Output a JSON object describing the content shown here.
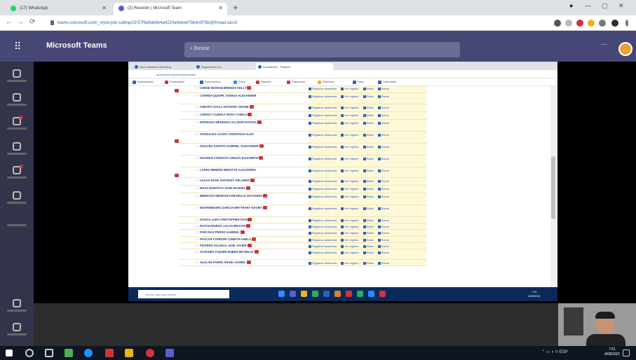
{
  "browser": {
    "tabs": [
      {
        "title": "(17) WhatsApp",
        "color": "#25d366"
      },
      {
        "title": "(2) Reunión | Microsoft Team",
        "color": "#5b5fc7"
      }
    ],
    "url": "teams.microsoft.com/_#/pre-join-calling/19:57f5e6de6e4a4220a4ebeb7bb4c0f7bb@thread.tacv2",
    "window_controls": [
      "—",
      "▢",
      "✕"
    ]
  },
  "teams": {
    "app_name": "Microsoft Teams",
    "search_placeholder": "Buscar",
    "more_label": "···",
    "rail": [
      {
        "icon": "activity-icon",
        "badge": false
      },
      {
        "icon": "chat-icon",
        "badge": false
      },
      {
        "icon": "teams-icon",
        "badge": true
      },
      {
        "icon": "assignments-icon",
        "badge": false
      },
      {
        "icon": "calendar-icon",
        "badge": true
      },
      {
        "icon": "calls-icon",
        "badge": false
      },
      {
        "icon": "more-apps-icon",
        "badge": false
      },
      {
        "icon": "apps-icon",
        "badge": false
      },
      {
        "icon": "help-icon",
        "badge": false
      }
    ]
  },
  "shared": {
    "tabs": [
      "Inicio (sistema educativo)",
      "Seguimiento de...",
      "Estudiantes - Registro"
    ],
    "url": "aulavirtual.edu/estudiantes/lista",
    "bookmarks": [
      "Aplicaciones",
      "Formularios",
      "Documentos",
      "Zoom",
      "Sistema",
      "Classroom",
      "Recursos",
      "Drive",
      "Calendario"
    ],
    "actions": [
      "Registrar asistencia",
      "Ver registro",
      "Editar",
      "Borrar"
    ],
    "rows": [
      {
        "name": "CHENE MAMANI BRENDA KELLY",
        "flag": true,
        "lead": true,
        "h": 11
      },
      {
        "name": "CORREA QUISPE JOSHUA ALEXANDER",
        "flag": false,
        "lead": false,
        "h": 16
      },
      {
        "name": "CRESPO AYALA ANTHONY SHANE",
        "flag": true,
        "lead": false,
        "h": 11
      },
      {
        "name": "CUENCA CUENCA ROSA CAMILA",
        "flag": true,
        "lead": false,
        "h": 11
      },
      {
        "name": "ESPINOZA MENDOZA ALLISON DAYANA",
        "flag": true,
        "lead": false,
        "h": 17
      },
      {
        "name": "GONZALES LOAIZA JONATHAN ALDO",
        "flag": false,
        "lead": true,
        "h": 17
      },
      {
        "name": "GUILLEN SANTOS GABRIEL ALEXANDER",
        "flag": true,
        "lead": false,
        "h": 17
      },
      {
        "name": "HUAMAN CORDOVA ASHLEY ELIZABETH",
        "flag": true,
        "lead": false,
        "h": 17
      },
      {
        "name": "LOPEZ MENDEZ BRIGITTE ALEJANDRA",
        "flag": false,
        "lead": true,
        "h": 15
      },
      {
        "name": "LUCAS ROSE ANTHONY ORLANDO",
        "flag": true,
        "lead": false,
        "h": 11
      },
      {
        "name": "MAZA MONTOYA JOSE MANUEL",
        "flag": true,
        "lead": false,
        "h": 11
      },
      {
        "name": "MENDOZA MENDOZA MICHELLE GIOVANNA",
        "flag": true,
        "lead": false,
        "h": 17
      },
      {
        "name": "MONTENEGRO GARCIA BRYTHANY NAOMY",
        "flag": true,
        "lead": false,
        "h": 17
      },
      {
        "name": "OCHOA LUNA CRISTOPHER IVAN",
        "flag": true,
        "lead": false,
        "h": 9
      },
      {
        "name": "PAITAN MUÑOZ LUCAS BRAYAN",
        "flag": true,
        "lead": false,
        "h": 9
      },
      {
        "name": "PARI DIAZ PEDRO GABRIEL",
        "flag": true,
        "lead": false,
        "h": 10
      },
      {
        "name": "PAUCAR CONDORI LISBETH ANELA",
        "flag": true,
        "lead": false,
        "h": 9
      },
      {
        "name": "PIZARRO SALINAS JOSE JAVIER",
        "flag": true,
        "lead": false,
        "h": 9
      },
      {
        "name": "SANCHEZ TAQUIRI RUBEN MICHELLE",
        "flag": true,
        "lead": false,
        "h": 15
      },
      {
        "name": "SUALAN FARRO ANGEL DANIEL",
        "flag": true,
        "lead": false,
        "h": 9
      }
    ],
    "taskbar_search": "Escribe aquí para buscar",
    "clock": [
      "7:51",
      "4/08/2021"
    ]
  },
  "desktop": {
    "tray": "ESP",
    "clock": [
      "7:51",
      "4/08/2021"
    ]
  }
}
